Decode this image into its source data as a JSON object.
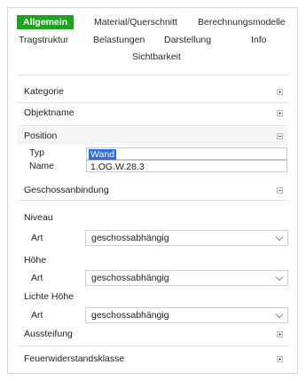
{
  "tabs": [
    {
      "label": "Allgemein",
      "active": true
    },
    {
      "label": "Material/Querschnitt",
      "active": false
    },
    {
      "label": "Berechnungsmodelle",
      "active": false
    },
    {
      "label": "Tragstruktur",
      "active": false
    },
    {
      "label": "Belastungen",
      "active": false
    },
    {
      "label": "Darstellung",
      "active": false
    },
    {
      "label": "Info",
      "active": false
    },
    {
      "label": "Sichtbarkeit",
      "active": false
    }
  ],
  "sections": {
    "kategorie": {
      "title": "Kategorie",
      "expanded": false
    },
    "objektname": {
      "title": "Objektname",
      "expanded": false
    },
    "position": {
      "title": "Position",
      "expanded": true
    },
    "geschoss": {
      "title": "Geschossanbindung",
      "expanded": true
    },
    "aussteifung": {
      "title": "Aussteifung",
      "expanded": false
    },
    "feuer": {
      "title": "Feuerwiderstandsklasse",
      "expanded": false
    }
  },
  "position": {
    "typ_label": "Typ",
    "typ_value": "Wand",
    "name_label": "Name",
    "name_value": "1.OG.W.28.3"
  },
  "geschoss": {
    "niveau_label": "Niveau",
    "hoehe_label": "Höhe",
    "lichte_label": "Lichte Höhe",
    "art_label": "Art",
    "niveau_art": "geschossabhängig",
    "hoehe_art": "geschossabhängig",
    "lichte_art": "geschossabhängig"
  },
  "colors": {
    "accent": "#1ea321",
    "selection": "#2f6ed6"
  }
}
